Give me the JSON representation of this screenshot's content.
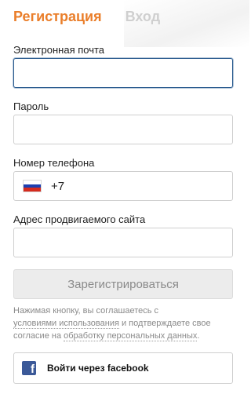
{
  "tabs": {
    "register": "Регистрация",
    "login": "Вход"
  },
  "form": {
    "email_label": "Электронная почта",
    "email_value": "",
    "password_label": "Пароль",
    "password_value": "",
    "phone_label": "Номер телефона",
    "phone_code": "+7",
    "phone_country_icon": "russia-flag-icon",
    "site_label": "Адрес продвигаемого сайта",
    "site_value": "",
    "submit_label": "Зарегистрироваться"
  },
  "terms": {
    "part1": "Нажимая кнопку, вы соглашаетесь с",
    "link1": "условиями использования",
    "part2": "и подтверждаете свое согласие на",
    "link2": "обработку персональных данных",
    "part3": "."
  },
  "social": {
    "facebook_label": "Войти через facebook",
    "facebook_icon": "facebook-icon"
  },
  "colors": {
    "accent": "#ea7e2a",
    "inactive_tab": "#cfcfcf",
    "focus_border": "#2a5b8f",
    "facebook": "#3b5998"
  }
}
